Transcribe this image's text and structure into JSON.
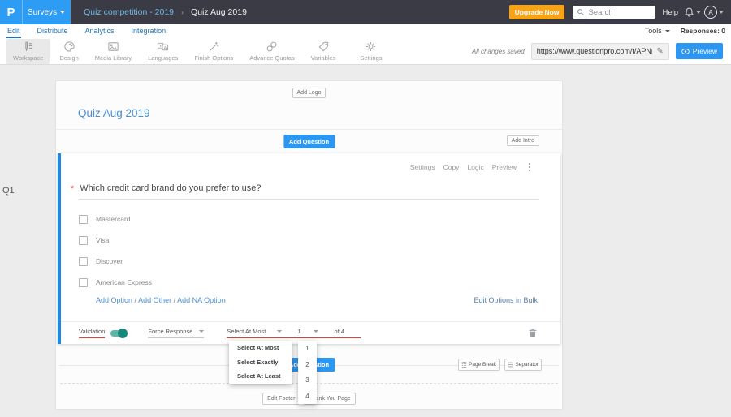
{
  "topbar": {
    "logo": "P",
    "app_menu": "Surveys",
    "breadcrumb": {
      "parent": "Quiz competition - 2019",
      "sep": "›",
      "current": "Quiz Aug 2019"
    },
    "upgrade": "Upgrade Now",
    "search_placeholder": "Search",
    "help": "Help",
    "avatar": "A"
  },
  "nav": {
    "tabs": [
      {
        "label": "Edit"
      },
      {
        "label": "Distribute"
      },
      {
        "label": "Analytics"
      },
      {
        "label": "Integration"
      }
    ],
    "tools": "Tools",
    "responses": "Responses: 0"
  },
  "toolbar": {
    "items": [
      {
        "label": "Workspace",
        "icon": "workspace-icon"
      },
      {
        "label": "Design",
        "icon": "design-icon"
      },
      {
        "label": "Media Library",
        "icon": "media-library-icon"
      },
      {
        "label": "Languages",
        "icon": "languages-icon"
      },
      {
        "label": "Finish Options",
        "icon": "finish-options-icon"
      },
      {
        "label": "Advance Quotas",
        "icon": "advance-quotas-icon"
      },
      {
        "label": "Variables",
        "icon": "variables-icon"
      },
      {
        "label": "Settings",
        "icon": "settings-icon"
      }
    ],
    "saved": "All changes saved",
    "url": "https://www.questionpro.com/t/APNrFZ",
    "preview": "Preview"
  },
  "survey": {
    "q_label": "Q1",
    "add_logo": "Add Logo",
    "title": "Quiz Aug 2019",
    "add_question": "Add Question",
    "add_intro": "Add Intro",
    "question": {
      "menu": [
        {
          "label": "Settings"
        },
        {
          "label": "Copy"
        },
        {
          "label": "Logic"
        },
        {
          "label": "Preview"
        }
      ],
      "required_mark": "*",
      "text": "Which credit card brand do you prefer to use?",
      "options": [
        {
          "label": "Mastercard"
        },
        {
          "label": "Visa"
        },
        {
          "label": "Discover"
        },
        {
          "label": "American Express"
        }
      ],
      "add_option": "Add Option",
      "add_other": "Add Other",
      "add_na": "Add NA Option",
      "slash": "/",
      "edit_bulk": "Edit Options in Bulk",
      "validation": {
        "label": "Validation",
        "force": "Force Response",
        "mode": "Select At Most",
        "count": "1",
        "of": "of 4"
      }
    },
    "footer": {
      "page_break": "Page Break",
      "separator": "Separator",
      "edit_footer": "Edit Footer",
      "thank_you": "Thank You Page"
    }
  },
  "dropdowns": {
    "modes": [
      {
        "label": "Select At Most"
      },
      {
        "label": "Select Exactly"
      },
      {
        "label": "Select At Least"
      }
    ],
    "counts": [
      {
        "label": "1"
      },
      {
        "label": "2"
      },
      {
        "label": "3"
      },
      {
        "label": "4"
      }
    ]
  },
  "colors": {
    "accent_blue": "#2d96f0",
    "brand_blue": "#2d9cf4",
    "link_blue": "#4a90d2",
    "nav_blue": "#2373b5",
    "orange": "#f7a319",
    "teal": "#12897b",
    "red_underline": "#db4437",
    "topbar_bg": "#3b3b45",
    "block_border": "#1e88e5"
  }
}
